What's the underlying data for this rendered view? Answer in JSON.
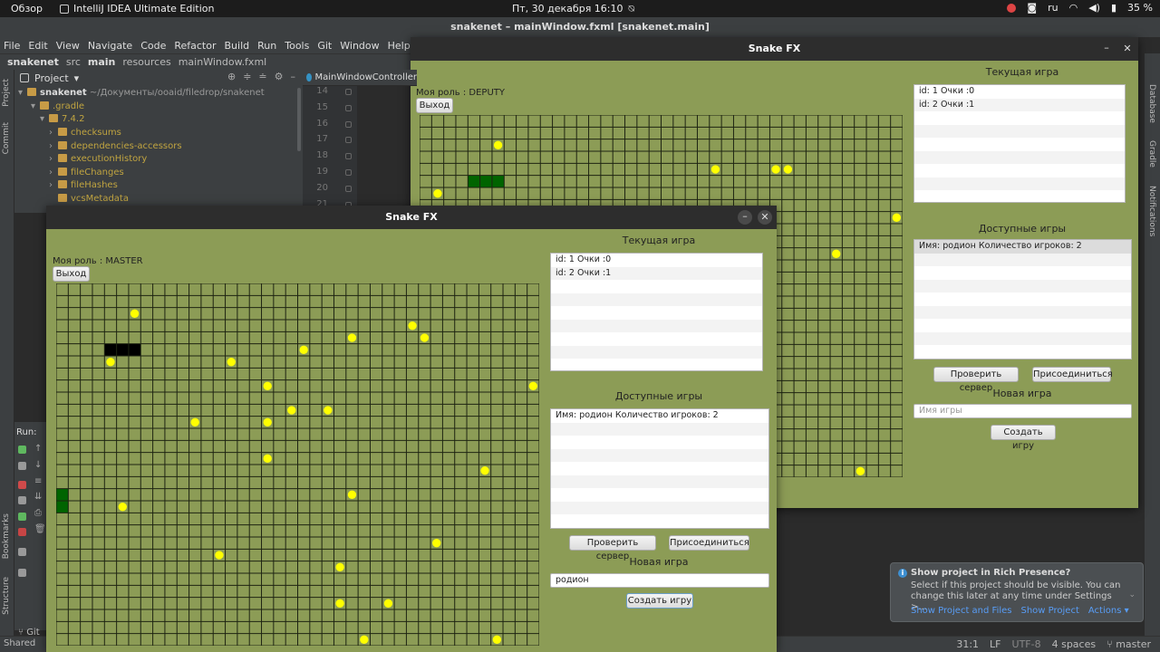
{
  "topbar": {
    "activities": "Обзор",
    "app_name": "IntelliJ IDEA Ultimate Edition",
    "clock": "Пт, 30 декабря  16:10",
    "lang": "ru",
    "battery": "35 %"
  },
  "ide": {
    "title": "snakenet – mainWindow.fxml [snakenet.main]",
    "menu": [
      "File",
      "Edit",
      "View",
      "Navigate",
      "Code",
      "Refactor",
      "Build",
      "Run",
      "Tools",
      "Git",
      "Window",
      "Help"
    ],
    "breadcrumb": [
      "snakenet",
      "src",
      "main",
      "resources",
      "mainWindow.fxml"
    ],
    "project_label": "Project",
    "editor_tab": "MainWindowController",
    "left_tabs": [
      "Project",
      "Commit",
      "Bookmarks",
      "Structure"
    ],
    "right_tabs": [
      "Database",
      "Gradle",
      "Notifications"
    ],
    "tree": [
      {
        "label": "snakenet",
        "path": "~/Документы/ooaid/filedrop/snakenet"
      },
      {
        "label": ".gradle"
      },
      {
        "label": "7.4.2"
      },
      {
        "label": "checksums"
      },
      {
        "label": "dependencies-accessors"
      },
      {
        "label": "executionHistory"
      },
      {
        "label": "fileChanges"
      },
      {
        "label": "fileHashes"
      },
      {
        "label": "vcsMetadata"
      }
    ],
    "line_numbers": [
      "14",
      "15",
      "16",
      "17",
      "18",
      "19",
      "20",
      "21"
    ],
    "run_label": "Run:",
    "bottom_left": [
      "Git",
      "Shared"
    ],
    "status": {
      "position": "31:1",
      "line_sep": "LF",
      "encoding": "UTF-8",
      "indent": "4 spaces",
      "branch": "master"
    },
    "notification": {
      "title": "Show project in Rich Presence?",
      "body": "Select if this project should be visible. You can change this later at any time under Settings >...",
      "actions": [
        "Show Project and Files",
        "Show Project",
        "Actions ▾"
      ]
    }
  },
  "win1": {
    "title": "Snake FX",
    "role": "Моя роль : DEPUTY",
    "exit_label": "Выход",
    "current_game_title": "Текущая игра",
    "current_game": [
      "id: 1 Очки :0",
      "id: 2 Очки :1"
    ],
    "available_title": "Доступные игры",
    "available": [
      "Имя: родион  Количество игроков: 2"
    ],
    "check_server": "Проверить сервер",
    "join": "Присоединиться",
    "new_game_title": "Новая игра",
    "name_placeholder": "Имя игры",
    "name_value": "",
    "create": "Создать игру"
  },
  "win2": {
    "title": "Snake FX",
    "role": "Моя роль : MASTER",
    "exit_label": "Выход",
    "current_game_title": "Текущая игра",
    "current_game": [
      "id: 1 Очки :0",
      "id: 2 Очки :1"
    ],
    "available_title": "Доступные игры",
    "available": [
      "Имя: родион  Количество игроков: 2"
    ],
    "check_server": "Проверить сервер",
    "join": "Присоединиться",
    "new_game_title": "Новая игра",
    "name_placeholder": "Имя игры",
    "name_value": "родион",
    "create": "Создать игру"
  },
  "colors": {
    "field_bg": "#8c9c56",
    "grid_line": "#1e2412",
    "food": "#ffff00",
    "snake_green": "#006400",
    "snake_black": "#000000"
  },
  "board2": {
    "cols": 40,
    "rows": 30,
    "food": [
      [
        6,
        2
      ],
      [
        4,
        6
      ],
      [
        14,
        6
      ],
      [
        19,
        10
      ],
      [
        20,
        5
      ],
      [
        17,
        8
      ],
      [
        5,
        18
      ],
      [
        13,
        22
      ],
      [
        31,
        21
      ],
      [
        30,
        4
      ],
      [
        35,
        15
      ],
      [
        23,
        26
      ],
      [
        22,
        10
      ],
      [
        24,
        4
      ],
      [
        39,
        8
      ],
      [
        11,
        11
      ],
      [
        17,
        14
      ],
      [
        24,
        17
      ],
      [
        27,
        26
      ],
      [
        25,
        29
      ],
      [
        36,
        29
      ],
      [
        29,
        3
      ],
      [
        19,
        31
      ],
      [
        17,
        11
      ],
      [
        23,
        23
      ]
    ],
    "snakes": [
      {
        "color": "#000000",
        "cells": [
          [
            4,
            5
          ],
          [
            5,
            5
          ],
          [
            6,
            5
          ]
        ]
      },
      {
        "color": "#006400",
        "cells": [
          [
            0,
            17
          ],
          [
            0,
            18
          ]
        ]
      }
    ]
  },
  "board1": {
    "cols": 40,
    "rows": 30,
    "food": [
      [
        6,
        2
      ],
      [
        1,
        6
      ],
      [
        24,
        4
      ],
      [
        29,
        4
      ],
      [
        30,
        4
      ],
      [
        39,
        8
      ],
      [
        34,
        11
      ],
      [
        36,
        29
      ]
    ],
    "snakes": [
      {
        "color": "#006400",
        "cells": [
          [
            4,
            5
          ],
          [
            5,
            5
          ],
          [
            6,
            5
          ]
        ]
      }
    ]
  }
}
